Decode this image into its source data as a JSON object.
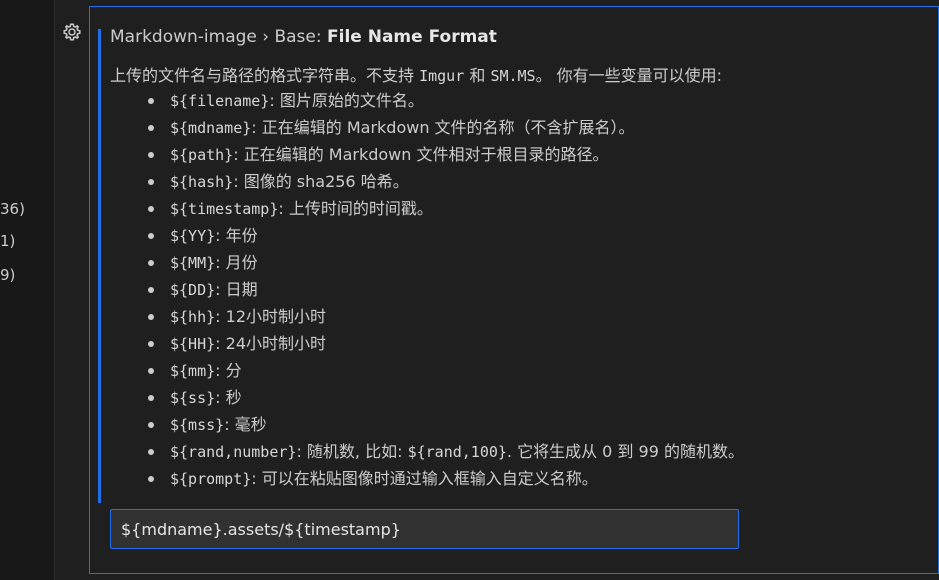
{
  "left_counts": [
    "36)",
    "1)",
    "9)"
  ],
  "setting": {
    "breadcrumb": "Markdown-image › Base: ",
    "name": "File Name Format",
    "desc_prefix": "上传的文件名与路径的格式字符串。不支持 ",
    "desc_imgur": "Imgur",
    "desc_and": " 和 ",
    "desc_smms": "SM.MS",
    "desc_suffix": "。 你有一些变量可以使用:",
    "variables": [
      {
        "code": "${filename}",
        "text": ": 图片原始的文件名。"
      },
      {
        "code": "${mdname}",
        "text": ": 正在编辑的 Markdown 文件的名称（不含扩展名）。"
      },
      {
        "code": "${path}",
        "text": ": 正在编辑的 Markdown 文件相对于根目录的路径。"
      },
      {
        "code": "${hash}",
        "text": ": 图像的 sha256 哈希。"
      },
      {
        "code": "${timestamp}",
        "text": ": 上传时间的时间戳。"
      },
      {
        "code": "${YY}",
        "text": ": 年份"
      },
      {
        "code": "${MM}",
        "text": ": 月份"
      },
      {
        "code": "${DD}",
        "text": ": 日期"
      },
      {
        "code": "${hh}",
        "text": ": 12小时制小时"
      },
      {
        "code": "${HH}",
        "text": ": 24小时制小时"
      },
      {
        "code": "${mm}",
        "text": ": 分"
      },
      {
        "code": "${ss}",
        "text": ": 秒"
      },
      {
        "code": "${mss}",
        "text": ": 毫秒"
      },
      {
        "code": "${rand,number}",
        "text": ": 随机数, 比如: ",
        "code2": "${rand,100}",
        "text2": ". 它将生成从 0 到 99 的随机数。"
      },
      {
        "code": "${prompt}",
        "text": ": 可以在粘贴图像时通过输入框输入自定义名称。"
      }
    ],
    "value": "${mdname}.assets/${timestamp}"
  },
  "icons": {
    "gear": "gear-icon"
  },
  "colors": {
    "focus_border": "#1f6feb",
    "background": "#1f1f1f",
    "input_bg": "#313131"
  }
}
